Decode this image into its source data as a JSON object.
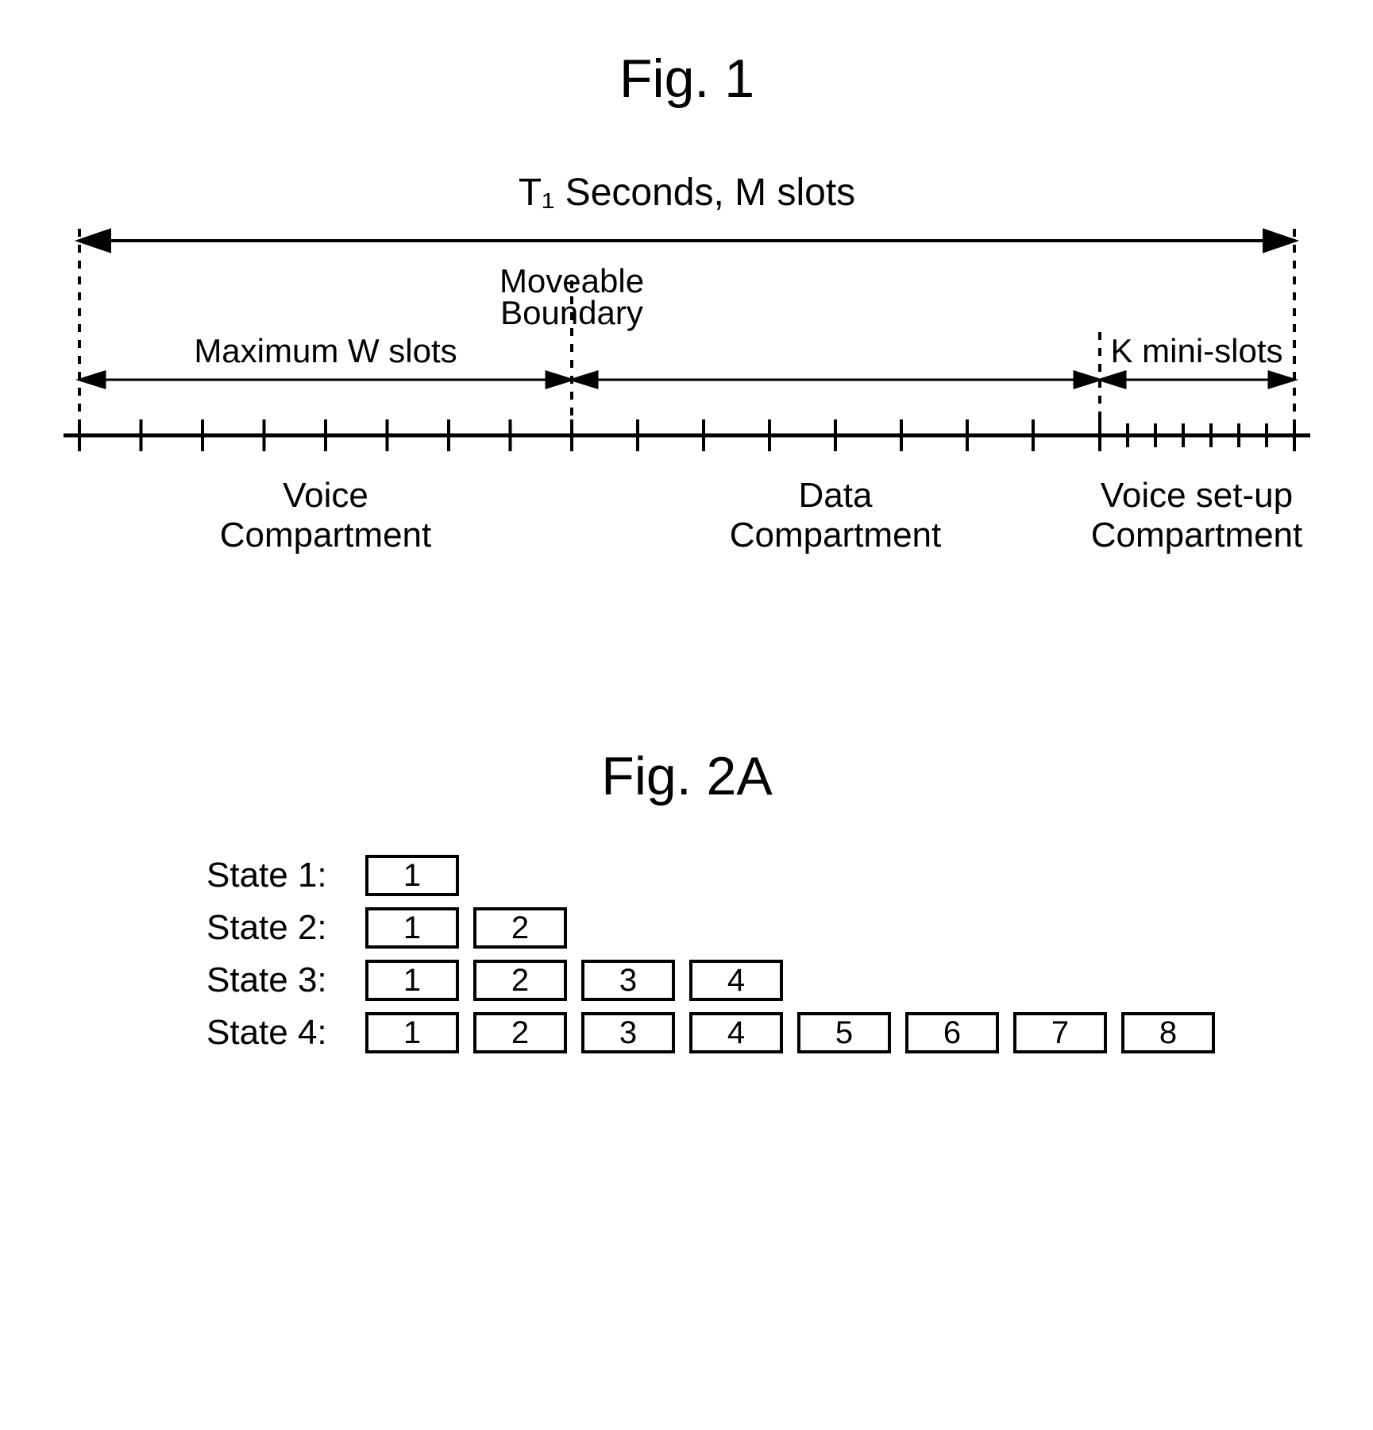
{
  "fig1": {
    "title": "Fig. 1",
    "topLabel": "T₁ Seconds, M slots",
    "movableBoundary": "Moveable\nBoundary",
    "wLabel": "Maximum W slots",
    "kLabel": "K mini-slots",
    "comp1a": "Voice",
    "comp1b": "Compartment",
    "comp2a": "Data",
    "comp2b": "Compartment",
    "comp3a": "Voice set-up",
    "comp3b": "Compartment"
  },
  "fig2a": {
    "title": "Fig. 2A"
  },
  "chart_data": {
    "type": "table",
    "title": "Fig. 2A state slot sequences",
    "rows": [
      {
        "label": "State 1:",
        "slots": [
          1
        ]
      },
      {
        "label": "State 2:",
        "slots": [
          1,
          2
        ]
      },
      {
        "label": "State 3:",
        "slots": [
          1,
          2,
          3,
          4
        ]
      },
      {
        "label": "State 4:",
        "slots": [
          1,
          2,
          3,
          4,
          5,
          6,
          7,
          8
        ]
      }
    ]
  }
}
